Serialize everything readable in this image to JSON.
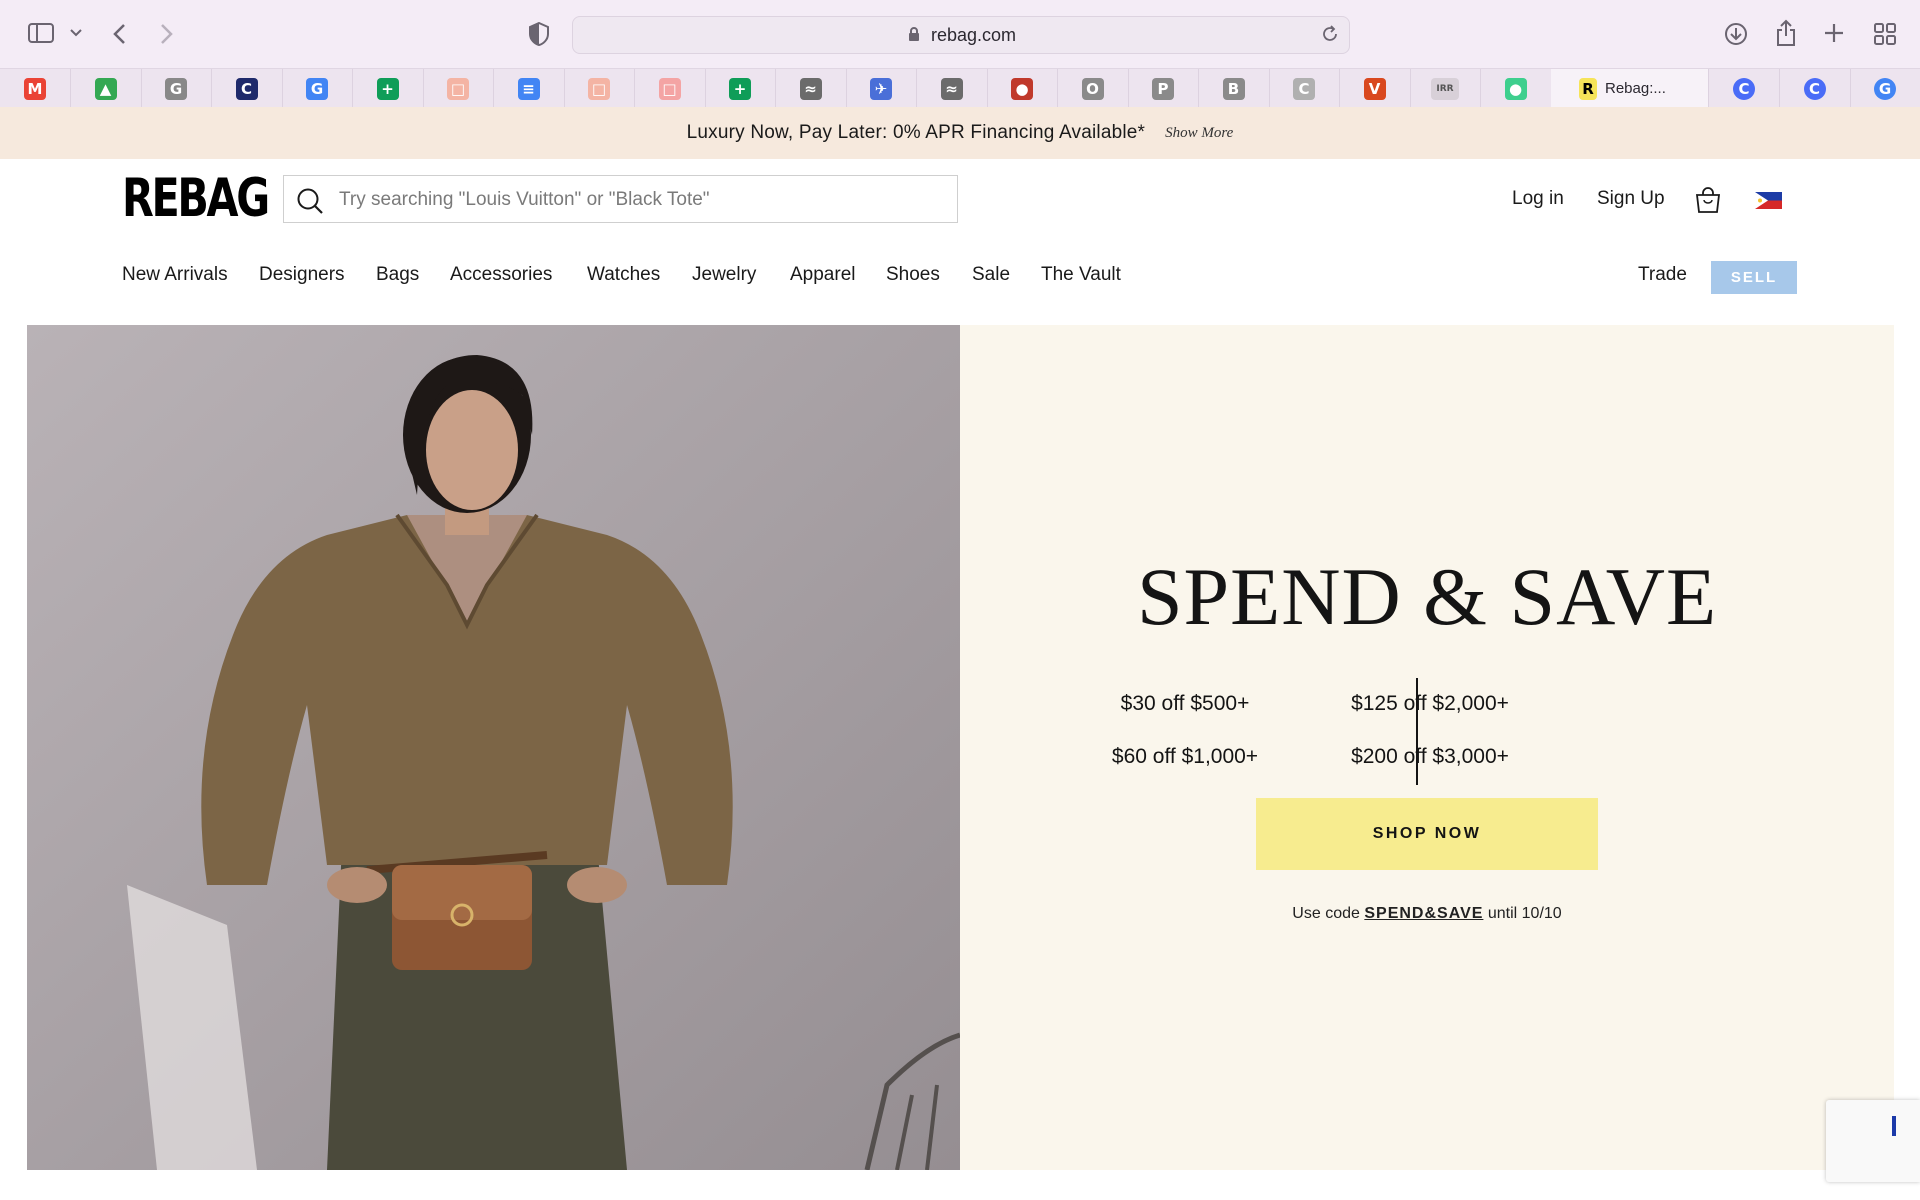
{
  "browser": {
    "url": "rebag.com",
    "active_tab_title": "Rebag:...",
    "favorites": [
      {
        "icon": "gmail-icon",
        "glyph": "M",
        "color": "#ea4335"
      },
      {
        "icon": "google-drive-icon",
        "glyph": "▲",
        "color": "#34a853"
      },
      {
        "icon": "grammarly-icon",
        "glyph": "G",
        "color": "#888888"
      },
      {
        "icon": "c-icon",
        "glyph": "C",
        "color": "#1f2a6b"
      },
      {
        "icon": "google-icon",
        "glyph": "G",
        "color": "#4285f4"
      },
      {
        "icon": "google-sheets-icon",
        "glyph": "+",
        "color": "#0f9d58"
      },
      {
        "icon": "slides-icon",
        "glyph": "□",
        "color": "#f4b4a4"
      },
      {
        "icon": "google-docs-icon",
        "glyph": "≡",
        "color": "#4285f4"
      },
      {
        "icon": "slides-icon",
        "glyph": "□",
        "color": "#f4b4a4"
      },
      {
        "icon": "slides-icon",
        "glyph": "□",
        "color": "#f4a4a4"
      },
      {
        "icon": "google-sheets-icon",
        "glyph": "+",
        "color": "#0f9d58"
      },
      {
        "icon": "wifi-icon",
        "glyph": "≈",
        "color": "#6b6b6b"
      },
      {
        "icon": "bird-icon",
        "glyph": "✈",
        "color": "#4a6fd8"
      },
      {
        "icon": "wifi-icon",
        "glyph": "≈",
        "color": "#6b6b6b"
      },
      {
        "icon": "circle-red-icon",
        "glyph": "●",
        "color": "#c0392b"
      },
      {
        "icon": "o-icon",
        "glyph": "O",
        "color": "#8a8a8a"
      },
      {
        "icon": "p-icon",
        "glyph": "P",
        "color": "#8a8a8a"
      },
      {
        "icon": "b-icon",
        "glyph": "B",
        "color": "#8a8a8a"
      },
      {
        "icon": "c-grey-icon",
        "glyph": "C",
        "color": "#b0b0b0"
      },
      {
        "icon": "v-icon",
        "glyph": "V",
        "color": "#d9481e"
      },
      {
        "icon": "irr-icon",
        "glyph": "IRR",
        "color": "#d8d0d8"
      },
      {
        "icon": "green-dot-icon",
        "glyph": "●",
        "color": "#3ecf8e"
      }
    ],
    "after_favorites": [
      {
        "icon": "blue-c-icon",
        "glyph": "C",
        "color": "#4a6cf7"
      },
      {
        "icon": "blue-c-icon",
        "glyph": "C",
        "color": "#4a6cf7"
      },
      {
        "icon": "google-icon",
        "glyph": "G",
        "color": "#4285f4"
      }
    ]
  },
  "promo": {
    "message": "Luxury Now, Pay Later: 0% APR Financing Available*",
    "show_more": "Show More"
  },
  "header": {
    "logo": "REBAG",
    "search_placeholder": "Try searching \"Louis Vuitton\" or \"Black Tote\"",
    "login": "Log in",
    "signup": "Sign Up"
  },
  "nav": {
    "items": [
      "New Arrivals",
      "Designers",
      "Bags",
      "Accessories",
      "Watches",
      "Jewelry",
      "Apparel",
      "Shoes",
      "Sale",
      "The Vault"
    ],
    "trade": "Trade",
    "sell": "SELL"
  },
  "hero": {
    "headline": "SPEND & SAVE",
    "offers_left": [
      "$30 off $500+",
      "$60 off $1,000+"
    ],
    "offers_right": [
      "$125 off $2,000+",
      "$200 off $3,000+"
    ],
    "cta": "SHOP NOW",
    "code_prefix": "Use code ",
    "code": "SPEND&SAVE",
    "code_suffix": " until 10/10"
  },
  "colors": {
    "promo_bg": "#f6e9dd",
    "panel_bg": "#faf6ec",
    "cta_bg": "#f7ec8f",
    "sell_bg": "#a7c8ea"
  }
}
